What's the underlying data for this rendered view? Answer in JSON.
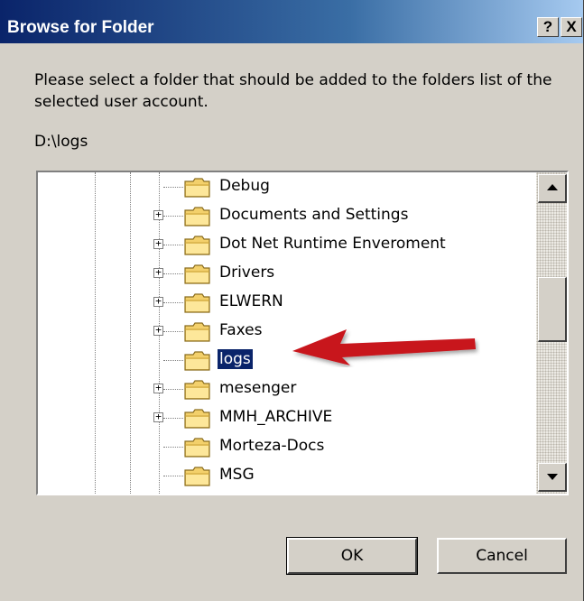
{
  "window": {
    "title": "Browse for Folder",
    "help_label": "?",
    "close_label": "X"
  },
  "prompt": "Please select a folder that should be added to the folders list of the selected user account.",
  "current_path": "D:\\logs",
  "tree": {
    "items": [
      {
        "label": "Debug",
        "expandable": false,
        "selected": false
      },
      {
        "label": "Documents and Settings",
        "expandable": true,
        "selected": false
      },
      {
        "label": "Dot Net Runtime Enveroment",
        "expandable": true,
        "selected": false
      },
      {
        "label": "Drivers",
        "expandable": true,
        "selected": false
      },
      {
        "label": "ELWERN",
        "expandable": true,
        "selected": false
      },
      {
        "label": "Faxes",
        "expandable": true,
        "selected": false
      },
      {
        "label": "logs",
        "expandable": false,
        "selected": true
      },
      {
        "label": "mesenger",
        "expandable": true,
        "selected": false
      },
      {
        "label": "MMH_ARCHIVE",
        "expandable": true,
        "selected": false
      },
      {
        "label": "Morteza-Docs",
        "expandable": false,
        "selected": false
      },
      {
        "label": "MSG",
        "expandable": false,
        "selected": false
      }
    ],
    "expander_glyph": "+",
    "folder_icon": "folder-icon",
    "scroll_position": 0.38
  },
  "buttons": {
    "ok": "OK",
    "cancel": "Cancel"
  },
  "colors": {
    "selection": "#0a246a",
    "annotation_arrow": "#c8141e"
  }
}
